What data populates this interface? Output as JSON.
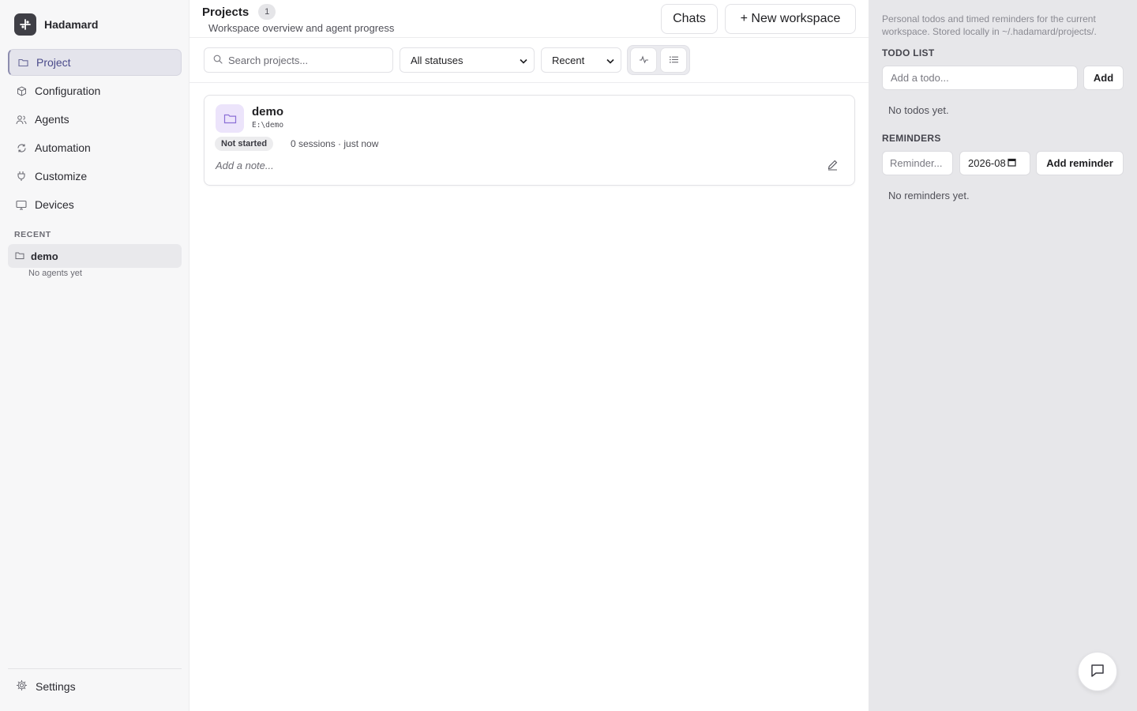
{
  "app": {
    "name": "Hadamard"
  },
  "sidebar": {
    "items": [
      {
        "label": "Project",
        "icon": "folder-icon",
        "active": true
      },
      {
        "label": "Configuration",
        "icon": "box-icon"
      },
      {
        "label": "Agents",
        "icon": "users-icon"
      },
      {
        "label": "Automation",
        "icon": "refresh-icon"
      },
      {
        "label": "Customize",
        "icon": "plug-icon"
      },
      {
        "label": "Devices",
        "icon": "monitor-icon"
      }
    ],
    "recent_heading": "RECENT",
    "recent": [
      {
        "label": "demo",
        "sub": "No agents yet",
        "icon": "folder-icon"
      }
    ],
    "settings_label": "Settings"
  },
  "header": {
    "title": "Projects",
    "count": "1",
    "subtitle": "Workspace overview and agent progress",
    "chats_label": "Chats",
    "new_workspace_label": "+ New workspace"
  },
  "toolbar": {
    "search_placeholder": "Search projects...",
    "status_filter": "All statuses",
    "sort": "Recent",
    "view_options": [
      "activity-view-icon",
      "list-view-icon"
    ]
  },
  "projects": [
    {
      "name": "demo",
      "path": "E:\\demo",
      "status": "Not started",
      "meta": "0 sessions · just now",
      "note_placeholder": "Add a note..."
    }
  ],
  "panel": {
    "description": "Personal todos and timed reminders for the current workspace. Stored locally in ~/.hadamard/projects/.",
    "todo_heading": "TODO LIST",
    "todo_placeholder": "Add a todo...",
    "add_label": "Add",
    "todo_empty": "No todos yet.",
    "reminders_heading": "REMINDERS",
    "reminder_placeholder": "Reminder...",
    "reminder_date": "2026-08",
    "add_reminder_label": "Add reminder",
    "reminders_empty": "No reminders yet."
  },
  "colors": {
    "accent": "#4a4a8a",
    "project_icon_bg": "#ece4fb",
    "project_icon": "#8b6fd6",
    "panel_bg": "#e7e7ea"
  }
}
